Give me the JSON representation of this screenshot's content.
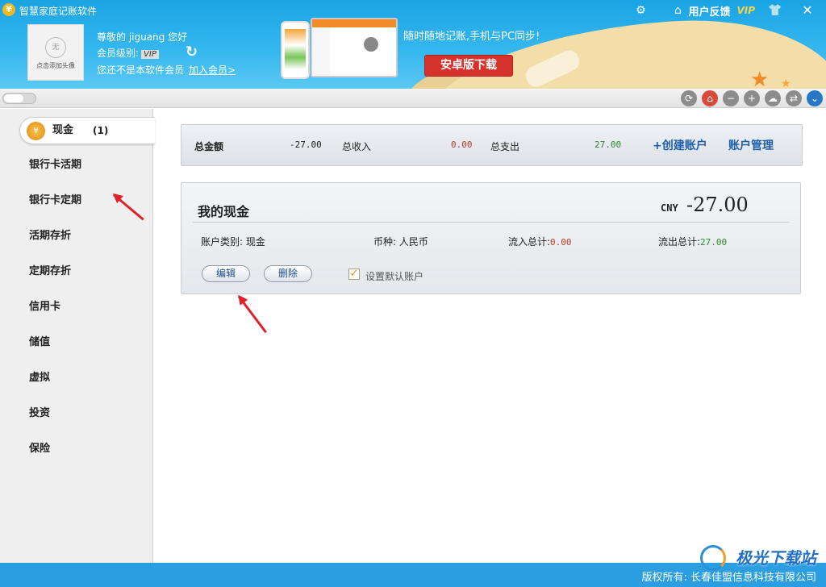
{
  "window": {
    "title": "智慧家庭记账软件",
    "logo_glyph": "¥",
    "feedback_label": "用户反馈",
    "vip_label": "VIP",
    "close_glyph": "✕"
  },
  "profile": {
    "avatar_glyph": "无",
    "avatar_label": "点击添加头像",
    "greeting": "尊敬的 jiguang 您好",
    "member_level_label": "会员级别:",
    "member_level_value": "VIP",
    "not_member_text": "您还不是本软件会员",
    "join_link": "加入会员>"
  },
  "banner": {
    "slogan": "随时随地记账,手机与PC同步!",
    "android_button": "安卓版下载"
  },
  "sidebar": {
    "active_item": {
      "label": "现金",
      "count": "(1)",
      "icon_glyph": "¥"
    },
    "items": [
      {
        "label": "银行卡活期"
      },
      {
        "label": "银行卡定期"
      },
      {
        "label": "活期存折"
      },
      {
        "label": "定期存折"
      },
      {
        "label": "信用卡"
      },
      {
        "label": "储值"
      },
      {
        "label": "虚拟"
      },
      {
        "label": "投资"
      },
      {
        "label": "保险"
      }
    ]
  },
  "summary": {
    "total_label": "总金额",
    "total_value": "-27.00",
    "income_label": "总收入",
    "income_value": "0.00",
    "expense_label": "总支出",
    "expense_value": "27.00",
    "create_account": "+创建账户",
    "manage_accounts": "账户管理"
  },
  "account_card": {
    "title": "我的现金",
    "currency_code": "CNY",
    "amount": "-27.00",
    "type_label": "账户类别:",
    "type_value": "现金",
    "currency_label": "币种:",
    "currency_value": "人民币",
    "inflow_label": "流入总计:",
    "inflow_value": "0.00",
    "outflow_label": "流出总计:",
    "outflow_value": "27.00",
    "edit_button": "编辑",
    "delete_button": "删除",
    "default_checkbox_label": "设置默认账户",
    "default_checked": true
  },
  "footer": {
    "copyright": "版权所有: 长春佳盟信息科技有限公司",
    "watermark": "极光下载站"
  },
  "colors": {
    "header_blue": "#1aa4e4",
    "footer_blue": "#2a9ee0",
    "income_red": "#c0392b",
    "expense_green": "#2e8b2e",
    "link_blue": "#1f5fa8",
    "annotation_red": "#e0202a"
  },
  "icons": [
    "network-icon",
    "home-icon",
    "shirt-icon",
    "close-icon",
    "refresh-icon",
    "home-circle-icon",
    "minus-circle-icon",
    "plus-circle-icon",
    "cloud-icon",
    "transfer-icon",
    "chevron-down-icon"
  ]
}
